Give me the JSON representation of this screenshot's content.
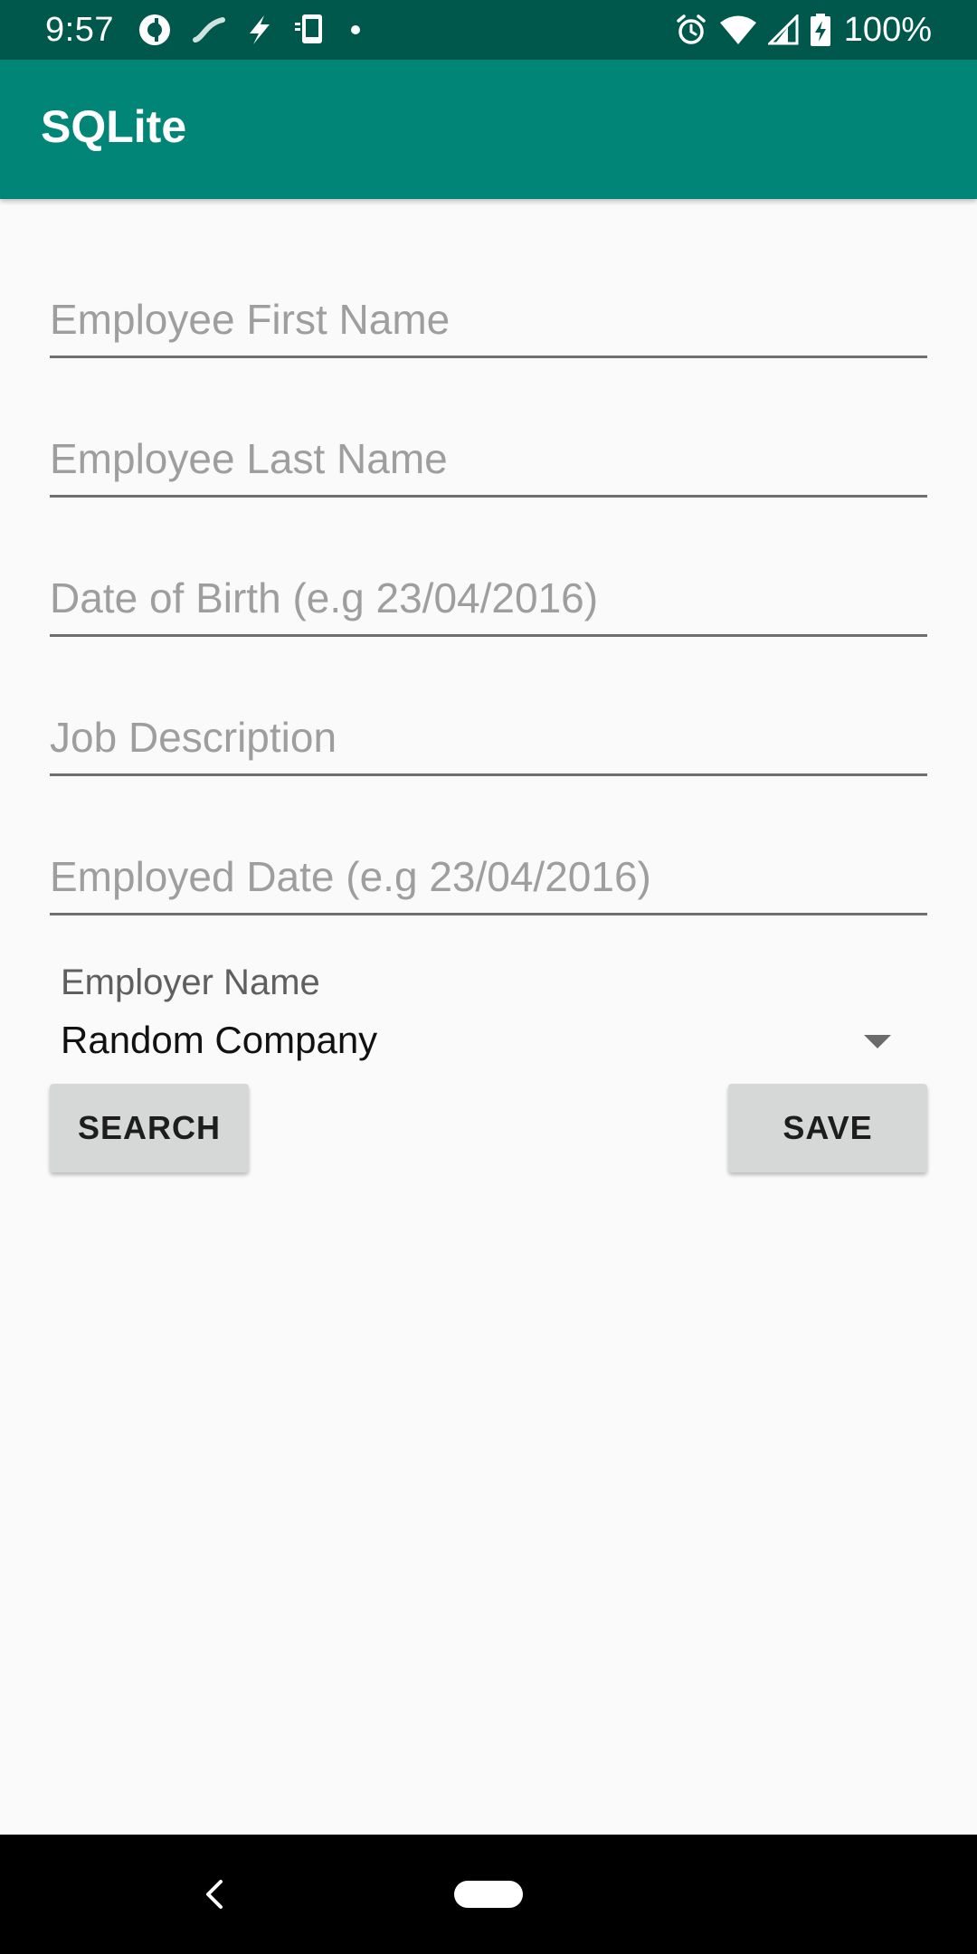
{
  "status_bar": {
    "time": "9:57",
    "battery_text": "100%",
    "icons_left": [
      "pocket-casts-icon",
      "link-icon",
      "bolt-icon",
      "device-icon",
      "dot-icon"
    ],
    "icons_right": [
      "alarm-icon",
      "wifi-icon",
      "signal-icon",
      "battery-charging-icon"
    ]
  },
  "app_bar": {
    "title": "SQLite",
    "color": "#008577"
  },
  "form": {
    "first_name": {
      "placeholder": "Employee First Name",
      "value": ""
    },
    "last_name": {
      "placeholder": "Employee Last Name",
      "value": ""
    },
    "date_of_birth": {
      "placeholder": "Date of Birth (e.g 23/04/2016)",
      "value": ""
    },
    "job_description": {
      "placeholder": "Job Description",
      "value": ""
    },
    "employed_date": {
      "placeholder": "Employed Date (e.g 23/04/2016)",
      "value": ""
    },
    "employer": {
      "label": "Employer Name",
      "selected": "Random Company"
    }
  },
  "buttons": {
    "search_label": "SEARCH",
    "save_label": "SAVE"
  },
  "colors": {
    "status_bar": "#00574b",
    "primary": "#008577",
    "button_bg": "#d6d7d7"
  }
}
